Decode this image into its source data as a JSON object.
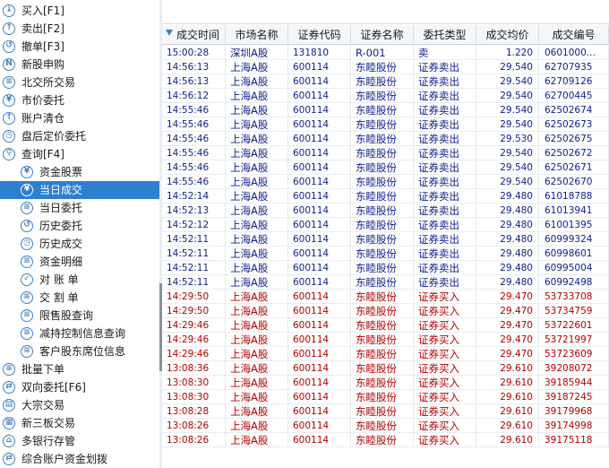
{
  "sidebar": {
    "items": [
      {
        "label": "买入[F1]",
        "icon": "buy-icon",
        "glyph": "↓",
        "level": 0
      },
      {
        "label": "卖出[F2]",
        "icon": "sell-icon",
        "glyph": "↑",
        "level": 0
      },
      {
        "label": "撤单[F3]",
        "icon": "cancel-order-icon",
        "glyph": "↺",
        "level": 0
      },
      {
        "label": "新股申购",
        "icon": "new-ipo-icon",
        "glyph": "N",
        "level": 0
      },
      {
        "label": "北交所交易",
        "icon": "bse-trading-icon",
        "glyph": "≡",
        "level": 0
      },
      {
        "label": "市价委托",
        "icon": "market-order-icon",
        "glyph": "¥",
        "level": 0
      },
      {
        "label": "账户清仓",
        "icon": "liquidate-icon",
        "glyph": "↑",
        "level": 0
      },
      {
        "label": "盘后定价委托",
        "icon": "after-hours-icon",
        "glyph": "◷",
        "level": 0
      },
      {
        "label": "查询[F4]",
        "icon": "query-icon",
        "glyph": "⚲",
        "level": 0
      },
      {
        "label": "资金股票",
        "icon": "funds-stocks-icon",
        "glyph": "¥",
        "level": 1
      },
      {
        "label": "当日成交",
        "icon": "today-deals-icon",
        "glyph": "¥",
        "level": 1,
        "selected": true
      },
      {
        "label": "当日委托",
        "icon": "today-orders-icon",
        "glyph": "≡",
        "level": 1
      },
      {
        "label": "历史委托",
        "icon": "history-orders-icon",
        "glyph": "↺",
        "level": 1
      },
      {
        "label": "历史成交",
        "icon": "history-deals-icon",
        "glyph": "◷",
        "level": 1
      },
      {
        "label": "资金明细",
        "icon": "fund-detail-icon",
        "glyph": "≡",
        "level": 1
      },
      {
        "label": "对 账 单",
        "icon": "statement-icon",
        "glyph": "✓",
        "level": 1
      },
      {
        "label": "交 割 单",
        "icon": "delivery-icon",
        "glyph": "≡",
        "level": 1
      },
      {
        "label": "限售股查询",
        "icon": "restricted-shares-icon",
        "glyph": "≡",
        "level": 1
      },
      {
        "label": "减持控制信息查询",
        "icon": "reduction-control-icon",
        "glyph": "≡",
        "level": 1
      },
      {
        "label": "客户股东席位信息",
        "icon": "shareholder-seat-icon",
        "glyph": "≡",
        "level": 1
      },
      {
        "label": "批量下单",
        "icon": "batch-order-icon",
        "glyph": "≡",
        "level": 0
      },
      {
        "label": "双向委托[F6]",
        "icon": "two-way-order-icon",
        "glyph": "⇄",
        "level": 0
      },
      {
        "label": "大宗交易",
        "icon": "block-trade-icon",
        "glyph": "▤",
        "level": 0
      },
      {
        "label": "新三板交易",
        "icon": "neeq-trading-icon",
        "glyph": "▦",
        "level": 0
      },
      {
        "label": "多银行存管",
        "icon": "multi-bank-icon",
        "glyph": "⌂",
        "level": 0
      },
      {
        "label": "综合账户资金划拨",
        "icon": "fund-transfer-icon",
        "glyph": "⇄",
        "level": 0
      }
    ]
  },
  "table": {
    "columns": [
      "成交时间",
      "市场名称",
      "证券代码",
      "证券名称",
      "委托类型",
      "成交均价",
      "成交编号"
    ],
    "rows": [
      {
        "time": "15:00:28",
        "market": "深圳A股",
        "code": "131810",
        "name": "R-001",
        "type": "卖",
        "price": "1.220",
        "no": "0601000...",
        "side": "sell"
      },
      {
        "time": "14:56:13",
        "market": "上海A股",
        "code": "600114",
        "name": "东睦股份",
        "type": "证券卖出",
        "price": "29.540",
        "no": "62707935",
        "side": "sell"
      },
      {
        "time": "14:56:13",
        "market": "上海A股",
        "code": "600114",
        "name": "东睦股份",
        "type": "证券卖出",
        "price": "29.540",
        "no": "62709126",
        "side": "sell"
      },
      {
        "time": "14:56:12",
        "market": "上海A股",
        "code": "600114",
        "name": "东睦股份",
        "type": "证券卖出",
        "price": "29.540",
        "no": "62700445",
        "side": "sell"
      },
      {
        "time": "14:55:46",
        "market": "上海A股",
        "code": "600114",
        "name": "东睦股份",
        "type": "证券卖出",
        "price": "29.540",
        "no": "62502674",
        "side": "sell"
      },
      {
        "time": "14:55:46",
        "market": "上海A股",
        "code": "600114",
        "name": "东睦股份",
        "type": "证券卖出",
        "price": "29.540",
        "no": "62502673",
        "side": "sell"
      },
      {
        "time": "14:55:46",
        "market": "上海A股",
        "code": "600114",
        "name": "东睦股份",
        "type": "证券卖出",
        "price": "29.530",
        "no": "62502675",
        "side": "sell"
      },
      {
        "time": "14:55:46",
        "market": "上海A股",
        "code": "600114",
        "name": "东睦股份",
        "type": "证券卖出",
        "price": "29.540",
        "no": "62502672",
        "side": "sell"
      },
      {
        "time": "14:55:46",
        "market": "上海A股",
        "code": "600114",
        "name": "东睦股份",
        "type": "证券卖出",
        "price": "29.540",
        "no": "62502671",
        "side": "sell"
      },
      {
        "time": "14:55:46",
        "market": "上海A股",
        "code": "600114",
        "name": "东睦股份",
        "type": "证券卖出",
        "price": "29.540",
        "no": "62502670",
        "side": "sell"
      },
      {
        "time": "14:52:14",
        "market": "上海A股",
        "code": "600114",
        "name": "东睦股份",
        "type": "证券卖出",
        "price": "29.480",
        "no": "61018788",
        "side": "sell"
      },
      {
        "time": "14:52:13",
        "market": "上海A股",
        "code": "600114",
        "name": "东睦股份",
        "type": "证券卖出",
        "price": "29.480",
        "no": "61013941",
        "side": "sell"
      },
      {
        "time": "14:52:12",
        "market": "上海A股",
        "code": "600114",
        "name": "东睦股份",
        "type": "证券卖出",
        "price": "29.480",
        "no": "61001395",
        "side": "sell"
      },
      {
        "time": "14:52:11",
        "market": "上海A股",
        "code": "600114",
        "name": "东睦股份",
        "type": "证券卖出",
        "price": "29.480",
        "no": "60999324",
        "side": "sell"
      },
      {
        "time": "14:52:11",
        "market": "上海A股",
        "code": "600114",
        "name": "东睦股份",
        "type": "证券卖出",
        "price": "29.480",
        "no": "60998601",
        "side": "sell"
      },
      {
        "time": "14:52:11",
        "market": "上海A股",
        "code": "600114",
        "name": "东睦股份",
        "type": "证券卖出",
        "price": "29.480",
        "no": "60995004",
        "side": "sell"
      },
      {
        "time": "14:52:11",
        "market": "上海A股",
        "code": "600114",
        "name": "东睦股份",
        "type": "证券卖出",
        "price": "29.480",
        "no": "60992498",
        "side": "sell"
      },
      {
        "time": "14:29:50",
        "market": "上海A股",
        "code": "600114",
        "name": "东睦股份",
        "type": "证券买入",
        "price": "29.470",
        "no": "53733708",
        "side": "buy"
      },
      {
        "time": "14:29:50",
        "market": "上海A股",
        "code": "600114",
        "name": "东睦股份",
        "type": "证券买入",
        "price": "29.470",
        "no": "53734759",
        "side": "buy"
      },
      {
        "time": "14:29:46",
        "market": "上海A股",
        "code": "600114",
        "name": "东睦股份",
        "type": "证券买入",
        "price": "29.470",
        "no": "53722601",
        "side": "buy"
      },
      {
        "time": "14:29:46",
        "market": "上海A股",
        "code": "600114",
        "name": "东睦股份",
        "type": "证券买入",
        "price": "29.470",
        "no": "53721997",
        "side": "buy"
      },
      {
        "time": "14:29:46",
        "market": "上海A股",
        "code": "600114",
        "name": "东睦股份",
        "type": "证券买入",
        "price": "29.470",
        "no": "53723609",
        "side": "buy"
      },
      {
        "time": "13:08:36",
        "market": "上海A股",
        "code": "600114",
        "name": "东睦股份",
        "type": "证券买入",
        "price": "29.610",
        "no": "39208072",
        "side": "buy"
      },
      {
        "time": "13:08:30",
        "market": "上海A股",
        "code": "600114",
        "name": "东睦股份",
        "type": "证券买入",
        "price": "29.610",
        "no": "39185944",
        "side": "buy"
      },
      {
        "time": "13:08:30",
        "market": "上海A股",
        "code": "600114",
        "name": "东睦股份",
        "type": "证券买入",
        "price": "29.610",
        "no": "39187245",
        "side": "buy"
      },
      {
        "time": "13:08:28",
        "market": "上海A股",
        "code": "600114",
        "name": "东睦股份",
        "type": "证券买入",
        "price": "29.610",
        "no": "39179968",
        "side": "buy"
      },
      {
        "time": "13:08:26",
        "market": "上海A股",
        "code": "600114",
        "name": "东睦股份",
        "type": "证券买入",
        "price": "29.610",
        "no": "39174998",
        "side": "buy"
      },
      {
        "time": "13:08:26",
        "market": "上海A股",
        "code": "600114",
        "name": "东睦股份",
        "type": "证券买入",
        "price": "29.610",
        "no": "39175118",
        "side": "buy"
      }
    ]
  },
  "colors": {
    "sell_text": "#0d1e8c",
    "buy_text": "#b30000",
    "selected_bg": "#2f7fd0",
    "icon": "#3f7fc2"
  }
}
